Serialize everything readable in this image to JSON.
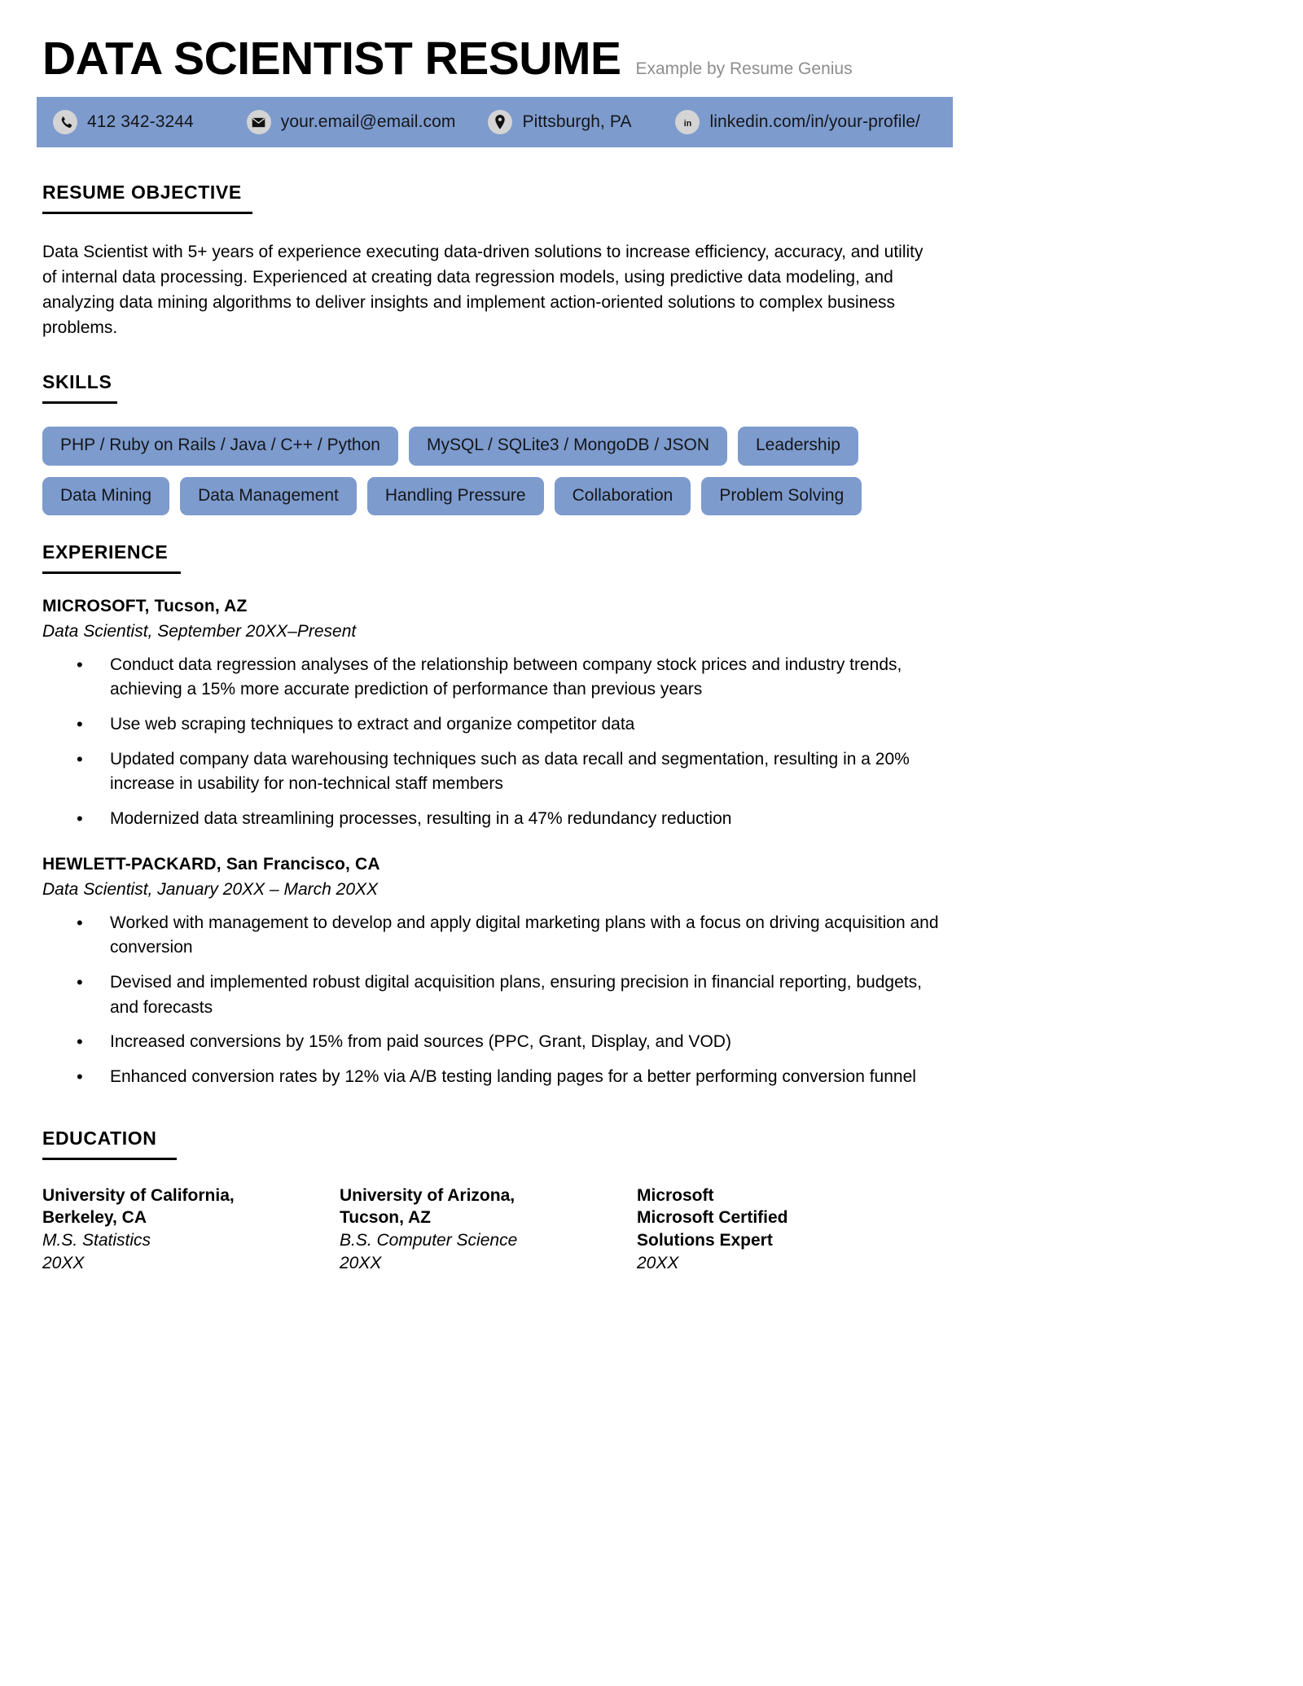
{
  "theme": {
    "accent": "#7d9bcd",
    "icon_circle": "#d4d4d4",
    "byline_gray": "#8d8d8d",
    "text": "#000000"
  },
  "header": {
    "title": "DATA SCIENTIST RESUME",
    "byline": "Example by Resume Genius"
  },
  "contact": [
    {
      "icon": "phone-icon",
      "text": "412 342-3244"
    },
    {
      "icon": "envelope-icon",
      "text": "your.email@email.com"
    },
    {
      "icon": "location-pin-icon",
      "text": "Pittsburgh, PA"
    },
    {
      "icon": "linkedin-icon",
      "text": "linkedin.com/in/your-profile/"
    }
  ],
  "objective": {
    "heading": "RESUME OBJECTIVE",
    "body": "Data Scientist with 5+ years of experience executing data-driven solutions to increase efficiency, accuracy, and utility of internal data processing. Experienced at creating data regression models, using predictive data modeling, and analyzing data mining algorithms to deliver insights and implement action-oriented solutions to complex business problems."
  },
  "skills": {
    "heading": "SKILLS",
    "items": [
      "PHP / Ruby on Rails / Java / C++ / Python",
      "MySQL / SQLite3 / MongoDB / JSON",
      "Leadership",
      "Data Mining",
      "Data Management",
      "Handling Pressure",
      "Collaboration",
      "Problem Solving"
    ]
  },
  "experience": {
    "heading": "EXPERIENCE",
    "jobs": [
      {
        "organization": "MICROSOFT, Tucson, AZ",
        "meta": "Data Scientist, September 20XX–Present",
        "bullets": [
          "Conduct data regression analyses of the relationship between company stock prices and industry trends, achieving a 15% more accurate prediction of performance than previous years",
          "Use web scraping techniques to extract and organize competitor data",
          "Updated company data warehousing techniques such as data recall and segmentation, resulting in a 20% increase in usability for non-technical staff members",
          "Modernized data streamlining processes, resulting in a 47% redundancy reduction"
        ]
      },
      {
        "organization": "HEWLETT-PACKARD, San Francisco, CA",
        "meta": "Data Scientist, January 20XX – March 20XX",
        "bullets": [
          "Worked with management to develop and apply digital marketing plans with a focus on driving acquisition and conversion",
          "Devised and implemented robust digital acquisition plans, ensuring precision in financial reporting, budgets, and forecasts",
          "Increased conversions by 15% from paid sources (PPC, Grant, Display, and VOD)",
          "Enhanced conversion rates by 12% via A/B testing landing pages for a better performing conversion funnel"
        ]
      }
    ]
  },
  "education": {
    "heading": "EDUCATION",
    "entries": [
      {
        "name": "University of California,\nBerkeley, CA",
        "degree": "M.S. Statistics",
        "degree_bold": false,
        "year": "20XX"
      },
      {
        "name": "University of Arizona,\nTucson, AZ",
        "degree": "B.S. Computer Science",
        "degree_bold": false,
        "year": "20XX"
      },
      {
        "name": "Microsoft\nMicrosoft Certified\nSolutions Expert",
        "degree": "",
        "degree_bold": true,
        "year": "20XX"
      }
    ]
  }
}
